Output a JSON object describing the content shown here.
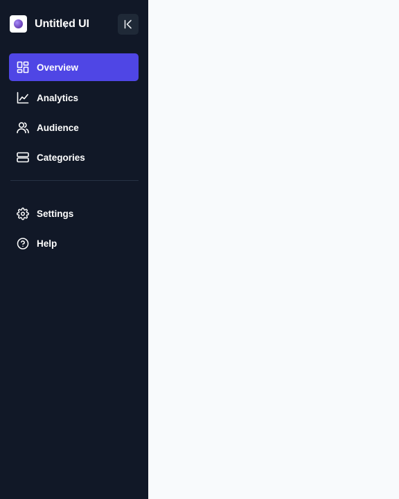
{
  "brand": {
    "name": "Untitled UI",
    "logo_icon": "logo-mark-icon"
  },
  "sidebar": {
    "collapse_icon": "collapse-left-icon",
    "primary_items": [
      {
        "label": "Overview",
        "icon": "grid-icon",
        "active": true
      },
      {
        "label": "Analytics",
        "icon": "line-chart-icon",
        "active": false
      },
      {
        "label": "Audience",
        "icon": "users-icon",
        "active": false
      },
      {
        "label": "Categories",
        "icon": "stack-icon",
        "active": false
      }
    ],
    "secondary_items": [
      {
        "label": "Settings",
        "icon": "gear-icon",
        "active": false
      },
      {
        "label": "Help",
        "icon": "help-circle-icon",
        "active": false
      }
    ]
  },
  "colors": {
    "sidebar_bg": "#111827",
    "active_bg": "#4f46e5",
    "main_bg": "#f8fafc",
    "text": "#ffffff"
  }
}
